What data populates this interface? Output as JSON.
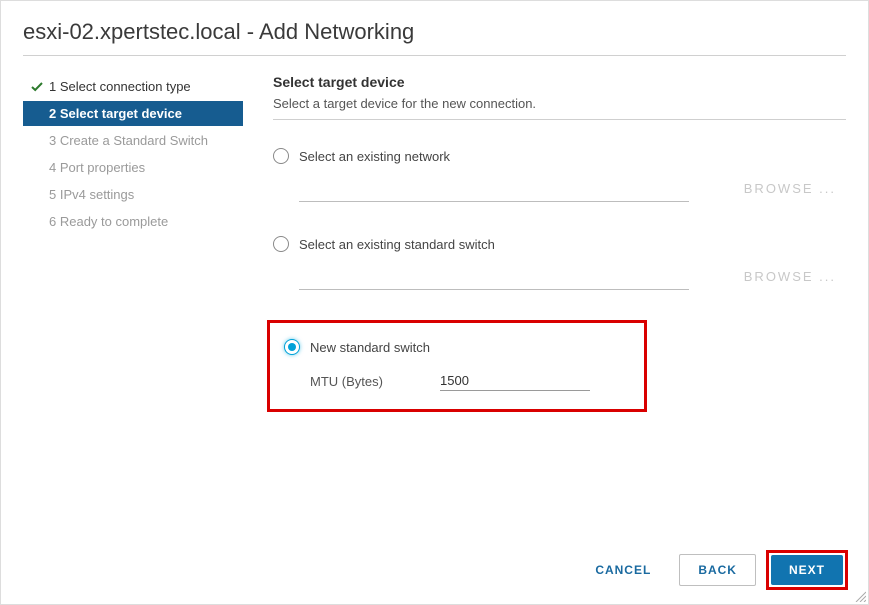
{
  "dialog": {
    "title": "esxi-02.xpertstec.local - Add Networking"
  },
  "sidebar": {
    "steps": [
      {
        "label": "1 Select connection type"
      },
      {
        "label": "2 Select target device"
      },
      {
        "label": "3 Create a Standard Switch"
      },
      {
        "label": "4 Port properties"
      },
      {
        "label": "5 IPv4 settings"
      },
      {
        "label": "6 Ready to complete"
      }
    ]
  },
  "main": {
    "section_title": "Select target device",
    "section_sub": "Select a target device for the new connection.",
    "options": {
      "existing_network": {
        "label": "Select an existing network",
        "browse": "BROWSE ..."
      },
      "existing_switch": {
        "label": "Select an existing standard switch",
        "browse": "BROWSE ..."
      },
      "new_switch": {
        "label": "New standard switch",
        "mtu_label": "MTU (Bytes)",
        "mtu_value": "1500"
      }
    }
  },
  "footer": {
    "cancel": "CANCEL",
    "back": "BACK",
    "next": "NEXT"
  }
}
